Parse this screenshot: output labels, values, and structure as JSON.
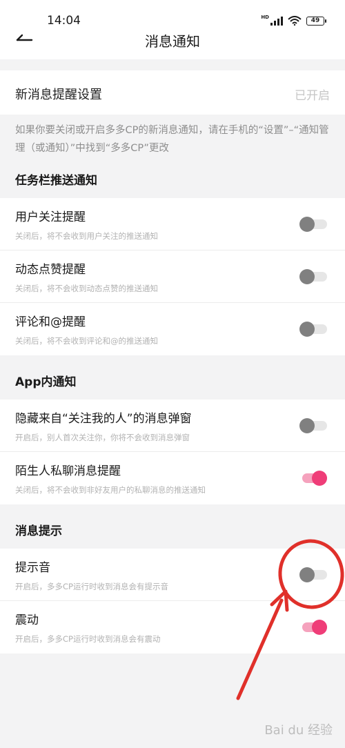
{
  "status_bar": {
    "time": "14:04",
    "network": "HD",
    "battery": "49"
  },
  "header": {
    "title": "消息通知"
  },
  "new_message": {
    "label": "新消息提醒设置",
    "value": "已开启"
  },
  "hint": "如果你要关闭或开启多多CP的新消息通知，请在手机的“设置”–“通知管理（或通知）”中找到“多多CP”更改",
  "sections": {
    "taskbar": {
      "title": "任务栏推送通知",
      "items": [
        {
          "title": "用户关注提醒",
          "sub": "关闭后，将不会收到用户关注的推送通知",
          "on": false
        },
        {
          "title": "动态点赞提醒",
          "sub": "关闭后，将不会收到动态点赞的推送通知",
          "on": false
        },
        {
          "title": "评论和@提醒",
          "sub": "关闭后，将不会收到评论和@的推送通知",
          "on": false
        }
      ]
    },
    "in_app": {
      "title": "App内通知",
      "items": [
        {
          "title": "隐藏来自“关注我的人”的消息弹窗",
          "sub": "开启后，别人首次关注你，你将不会收到消息弹窗",
          "on": false
        },
        {
          "title": "陌生人私聊消息提醒",
          "sub": "关闭后，将不会收到非好友用户的私聊消息的推送通知",
          "on": true
        }
      ]
    },
    "tips": {
      "title": "消息提示",
      "items": [
        {
          "title": "提示音",
          "sub": "开启后，多多CP运行时收到消息会有提示音",
          "on": false
        },
        {
          "title": "震动",
          "sub": "开启后，多多CP运行时收到消息会有震动",
          "on": true
        }
      ]
    }
  },
  "watermark": "Bai du 经验",
  "colors": {
    "accent": "#ef3d78",
    "annotation": "#e0302a"
  }
}
